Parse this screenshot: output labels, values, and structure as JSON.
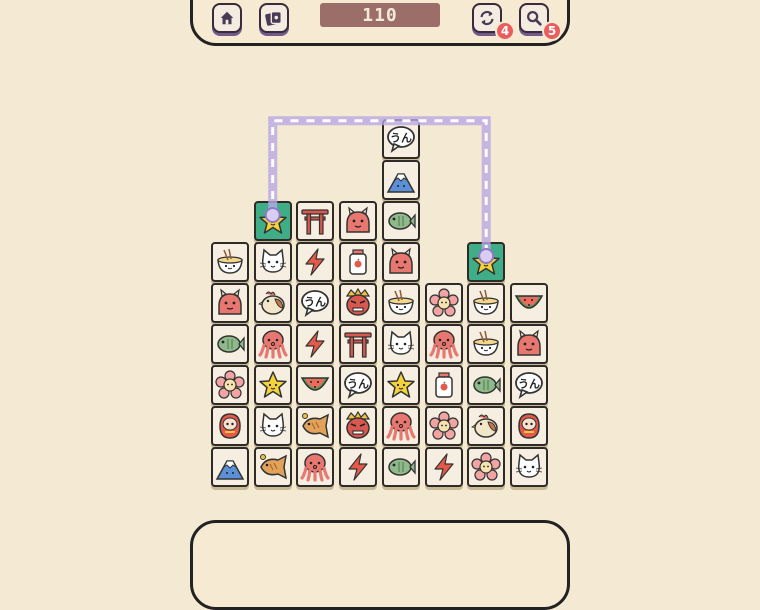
{
  "hud": {
    "score": "110",
    "shuffle_count": "4",
    "hint_count": "5",
    "icons": {
      "home": "home-icon",
      "themes": "cards-icon",
      "shuffle": "shuffle-icon",
      "hint": "magnifier-icon"
    }
  },
  "colors": {
    "background": "#f4e9d2",
    "tile": "#f6eee0",
    "selected": "#3fae86",
    "path": "#b9a7e3",
    "badge": "#e95d5d"
  },
  "board": {
    "tiles": [
      {
        "row": 0,
        "col": 4,
        "type": "speech"
      },
      {
        "row": 1,
        "col": 4,
        "type": "fuji"
      },
      {
        "row": 2,
        "col": 1,
        "type": "star",
        "selected": true
      },
      {
        "row": 2,
        "col": 2,
        "type": "torii"
      },
      {
        "row": 2,
        "col": 3,
        "type": "oni"
      },
      {
        "row": 2,
        "col": 4,
        "type": "fish"
      },
      {
        "row": 3,
        "col": 0,
        "type": "ramen"
      },
      {
        "row": 3,
        "col": 1,
        "type": "cat"
      },
      {
        "row": 3,
        "col": 2,
        "type": "bolt"
      },
      {
        "row": 3,
        "col": 3,
        "type": "jar"
      },
      {
        "row": 3,
        "col": 4,
        "type": "oni"
      },
      {
        "row": 3,
        "col": 6,
        "type": "star",
        "selected": true
      },
      {
        "row": 4,
        "col": 0,
        "type": "oni"
      },
      {
        "row": 4,
        "col": 1,
        "type": "rooster"
      },
      {
        "row": 4,
        "col": 2,
        "type": "speech"
      },
      {
        "row": 4,
        "col": 3,
        "type": "angry"
      },
      {
        "row": 4,
        "col": 4,
        "type": "ramen"
      },
      {
        "row": 4,
        "col": 5,
        "type": "flower"
      },
      {
        "row": 4,
        "col": 6,
        "type": "ramen"
      },
      {
        "row": 4,
        "col": 7,
        "type": "watermelon"
      },
      {
        "row": 5,
        "col": 0,
        "type": "fish"
      },
      {
        "row": 5,
        "col": 1,
        "type": "octopus"
      },
      {
        "row": 5,
        "col": 2,
        "type": "bolt"
      },
      {
        "row": 5,
        "col": 3,
        "type": "torii"
      },
      {
        "row": 5,
        "col": 4,
        "type": "cat"
      },
      {
        "row": 5,
        "col": 5,
        "type": "octopus"
      },
      {
        "row": 5,
        "col": 6,
        "type": "ramen"
      },
      {
        "row": 5,
        "col": 7,
        "type": "oni"
      },
      {
        "row": 6,
        "col": 0,
        "type": "flower"
      },
      {
        "row": 6,
        "col": 1,
        "type": "star"
      },
      {
        "row": 6,
        "col": 2,
        "type": "watermelon"
      },
      {
        "row": 6,
        "col": 3,
        "type": "speech"
      },
      {
        "row": 6,
        "col": 4,
        "type": "star"
      },
      {
        "row": 6,
        "col": 5,
        "type": "jar"
      },
      {
        "row": 6,
        "col": 6,
        "type": "fish"
      },
      {
        "row": 6,
        "col": 7,
        "type": "speech"
      },
      {
        "row": 7,
        "col": 0,
        "type": "daruma"
      },
      {
        "row": 7,
        "col": 1,
        "type": "cat"
      },
      {
        "row": 7,
        "col": 2,
        "type": "taiyaki"
      },
      {
        "row": 7,
        "col": 3,
        "type": "angry"
      },
      {
        "row": 7,
        "col": 4,
        "type": "octopus"
      },
      {
        "row": 7,
        "col": 5,
        "type": "flower"
      },
      {
        "row": 7,
        "col": 6,
        "type": "rooster"
      },
      {
        "row": 7,
        "col": 7,
        "type": "daruma"
      },
      {
        "row": 8,
        "col": 0,
        "type": "fuji"
      },
      {
        "row": 8,
        "col": 1,
        "type": "taiyaki"
      },
      {
        "row": 8,
        "col": 2,
        "type": "octopus"
      },
      {
        "row": 8,
        "col": 3,
        "type": "bolt"
      },
      {
        "row": 8,
        "col": 4,
        "type": "fish"
      },
      {
        "row": 8,
        "col": 5,
        "type": "bolt"
      },
      {
        "row": 8,
        "col": 6,
        "type": "flower"
      },
      {
        "row": 8,
        "col": 7,
        "type": "cat"
      }
    ],
    "speech_text": "うん",
    "link_path": [
      {
        "row": 2,
        "col": 1
      },
      {
        "row": -0.3,
        "col": 1
      },
      {
        "row": -0.3,
        "col": 6
      },
      {
        "row": 3,
        "col": 6
      }
    ]
  }
}
